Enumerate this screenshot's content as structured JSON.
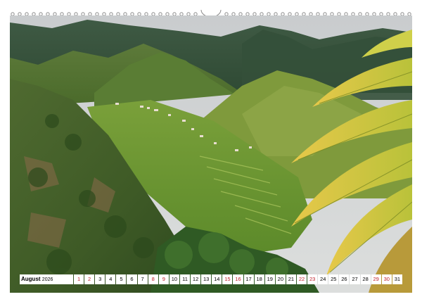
{
  "calendar": {
    "month": "August",
    "year": "2026",
    "days": [
      {
        "n": "1",
        "weekend": true
      },
      {
        "n": "2",
        "weekend": true
      },
      {
        "n": "3",
        "weekend": false
      },
      {
        "n": "4",
        "weekend": false
      },
      {
        "n": "5",
        "weekend": false
      },
      {
        "n": "6",
        "weekend": false
      },
      {
        "n": "7",
        "weekend": false
      },
      {
        "n": "8",
        "weekend": true
      },
      {
        "n": "9",
        "weekend": true
      },
      {
        "n": "10",
        "weekend": false
      },
      {
        "n": "11",
        "weekend": false
      },
      {
        "n": "12",
        "weekend": false
      },
      {
        "n": "13",
        "weekend": false
      },
      {
        "n": "14",
        "weekend": false
      },
      {
        "n": "15",
        "weekend": true
      },
      {
        "n": "16",
        "weekend": true
      },
      {
        "n": "17",
        "weekend": false
      },
      {
        "n": "18",
        "weekend": false
      },
      {
        "n": "19",
        "weekend": false
      },
      {
        "n": "20",
        "weekend": false
      },
      {
        "n": "21",
        "weekend": false
      },
      {
        "n": "22",
        "weekend": true
      },
      {
        "n": "23",
        "weekend": true
      },
      {
        "n": "24",
        "weekend": false
      },
      {
        "n": "25",
        "weekend": false
      },
      {
        "n": "26",
        "weekend": false
      },
      {
        "n": "27",
        "weekend": false
      },
      {
        "n": "28",
        "weekend": false
      },
      {
        "n": "29",
        "weekend": true
      },
      {
        "n": "30",
        "weekend": true
      },
      {
        "n": "31",
        "weekend": false
      }
    ],
    "weekend_color": "#c0202a"
  },
  "photo": {
    "subject": "mountain-valley-with-palm-icon"
  }
}
